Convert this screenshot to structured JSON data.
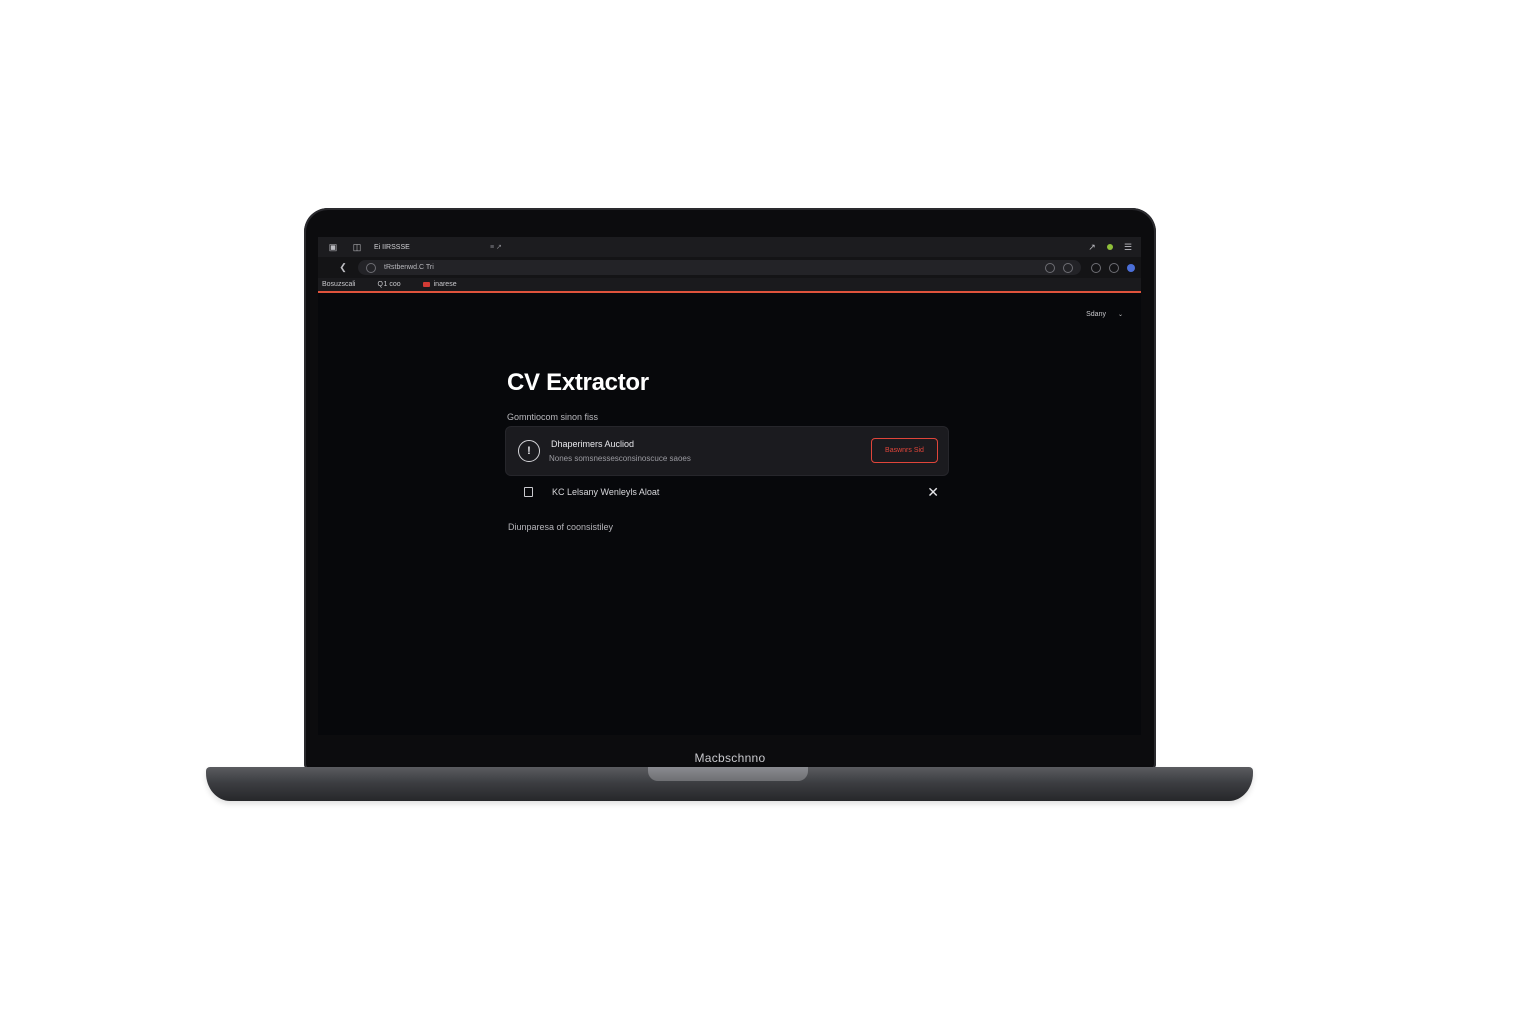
{
  "device": {
    "label": "Macbschnno"
  },
  "browser": {
    "tab_title": "Ei IIRSSSE",
    "tab_extra": "≡   ↗",
    "address": "tRstbenwd.C  Tri",
    "bookmarks": [
      {
        "label": "Bosuzscali"
      },
      {
        "label": "Q 1 coo"
      },
      {
        "label": "inarese"
      }
    ]
  },
  "page": {
    "language_selector": "Sdany",
    "title": "CV Extractor",
    "subtitle": "Gomntiocom sinon fiss",
    "alert": {
      "title": "Dhaperimers Aucliod",
      "description": "Nones somsnessesconsinoscuce saoes",
      "button_label": "Baswnrs Sid"
    },
    "file": {
      "name": "KC Lelsany Wenleyls   Aloat"
    },
    "footnote": "Diunparesa of coonsistiley"
  },
  "colors": {
    "accent": "#e0453a",
    "background": "#07080b",
    "card": "#1b1b1f"
  }
}
